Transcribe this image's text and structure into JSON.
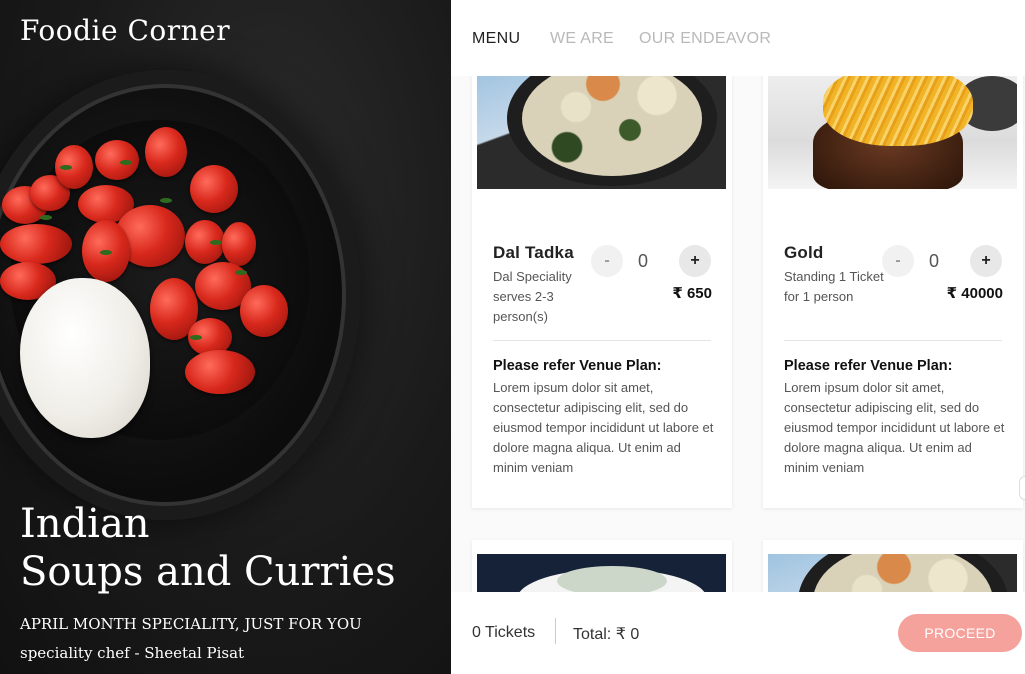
{
  "hero": {
    "brand": "Foodie Corner",
    "title_line1": "Indian",
    "title_line2": "Soups and Curries",
    "subtitle": "APRIL MONTH SPECIALITY, JUST FOR YOU",
    "chef": "speciality chef - Sheetal Pisat"
  },
  "nav": {
    "items": [
      {
        "label": "MENU",
        "active": true
      },
      {
        "label": "WE ARE",
        "active": false
      },
      {
        "label": "OUR ENDEAVOR",
        "active": false
      }
    ]
  },
  "cards": [
    {
      "name": "Dal Tadka",
      "desc": "Dal Speciality serves 2-3 person(s)",
      "minus": "-",
      "qty": "0",
      "plus": "+",
      "price": "₹ 650",
      "venue_title": "Please refer Venue Plan:",
      "venue_text": "Lorem ipsum dolor sit amet, consectetur adipiscing elit, sed do eiusmod tempor incididunt ut labore et dolore magna aliqua. Ut enim ad minim veniam"
    },
    {
      "name": "Gold",
      "desc": "Standing 1 Ticket for 1 person",
      "minus": "-",
      "qty": "0",
      "plus": "+",
      "price": "₹ 40000",
      "venue_title": "Please refer Venue Plan:",
      "venue_text": "Lorem ipsum dolor sit amet, consectetur adipiscing elit, sed do eiusmod tempor incididunt ut labore et dolore magna aliqua. Ut enim ad minim veniam"
    }
  ],
  "footer": {
    "tickets": "0 Tickets",
    "total": "Total: ₹ 0",
    "proceed": "PROCEED"
  },
  "colors": {
    "accent": "#f5a19c",
    "text_dark": "#222222",
    "nav_inactive": "#b9b9b9"
  }
}
